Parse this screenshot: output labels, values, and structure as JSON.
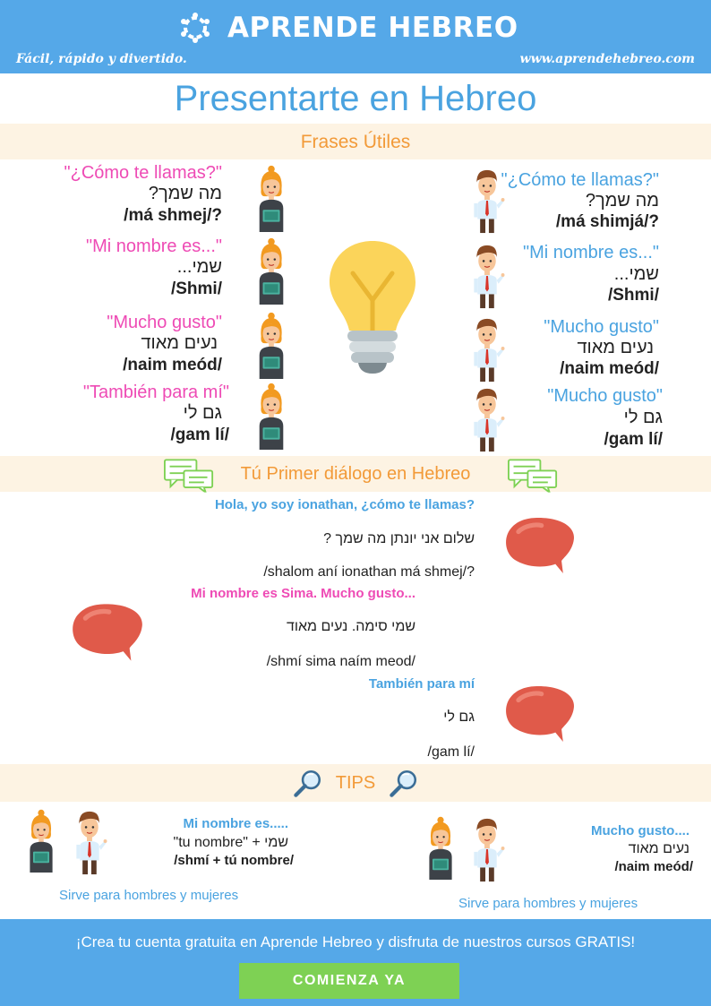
{
  "header": {
    "brand": "APRENDE HEBREO",
    "tagline": "Fácil, rápido y divertido.",
    "url": "www.aprendehebreo.com",
    "color": "#55a8e8"
  },
  "title": "Presentarte en Hebreo",
  "phrases": {
    "heading": "Frases Útiles",
    "female": [
      {
        "es": "\"¿Cómo te llamas?\"",
        "he": "מה שמך?",
        "tr": "/má shmej/?"
      },
      {
        "es": "\"Mi nombre es...\"",
        "he": "שמי...",
        "tr": "/Shmi/"
      },
      {
        "es": "\"Mucho gusto\"",
        "he": "נעים מאוד",
        "tr": "/naim meód/"
      },
      {
        "es": "\"También para mí\"",
        "he": "גם לי",
        "tr": "/gam lí/"
      }
    ],
    "male": [
      {
        "es": "\"¿Cómo te llamas?\"",
        "he": "מה שמך?",
        "tr": "/má shimjá/?"
      },
      {
        "es": "\"Mi nombre es...\"",
        "he": "שמי...",
        "tr": "/Shmi/"
      },
      {
        "es": "\"Mucho gusto\"",
        "he": "נעים מאוד",
        "tr": "/naim meód/"
      },
      {
        "es": "\"Mucho gusto\"",
        "he": "גם לי",
        "tr": "/gam lí/"
      }
    ]
  },
  "dialog": {
    "heading": "Tú Primer diálogo en Hebreo",
    "lines": [
      {
        "es": "Hola, yo soy ionathan, ¿cómo te llamas?",
        "he": "שלום אני יונתן מה שמך ?",
        "tr": "/shalom aní ionathan má shmej/?"
      },
      {
        "es": "Mi nombre es Sima. Mucho gusto...",
        "he": "שמי סימה. נעים מאוד",
        "tr": "/shmí sima naím meod/"
      },
      {
        "es": "También para mí",
        "he": "גם לי",
        "tr": "/gam lí/"
      }
    ]
  },
  "tips": {
    "heading": "TIPS",
    "left": {
      "es": "Mi nombre es.....",
      "he": "\"tu nombre\" + שמי",
      "tr": "/shmí + tú nombre/",
      "note": "Sirve para hombres y mujeres"
    },
    "right": {
      "es": "Mucho gusto....",
      "he": "נעים מאוד",
      "tr": "/naim meód/",
      "note": "Sirve para hombres y mujeres"
    }
  },
  "footer": {
    "text": "¡Crea tu cuenta gratuita en Aprende Hebreo y disfruta de nuestros cursos GRATIS!",
    "cta": "COMIENZA YA"
  },
  "icons": {
    "logo": "logo-flower-icon",
    "bulb": "lightbulb-icon",
    "chat": "chat-bubbles-icon",
    "speech": "speech-bubble-icon",
    "search": "magnifier-icon",
    "woman": "woman-avatar-icon",
    "man": "man-avatar-icon"
  },
  "colors": {
    "pink": "#ee4bb5",
    "blue": "#4aa3e0",
    "orange": "#f29a38",
    "band": "#fdf3e3",
    "cta": "#7ed154",
    "bubble": "#e05a4a"
  }
}
